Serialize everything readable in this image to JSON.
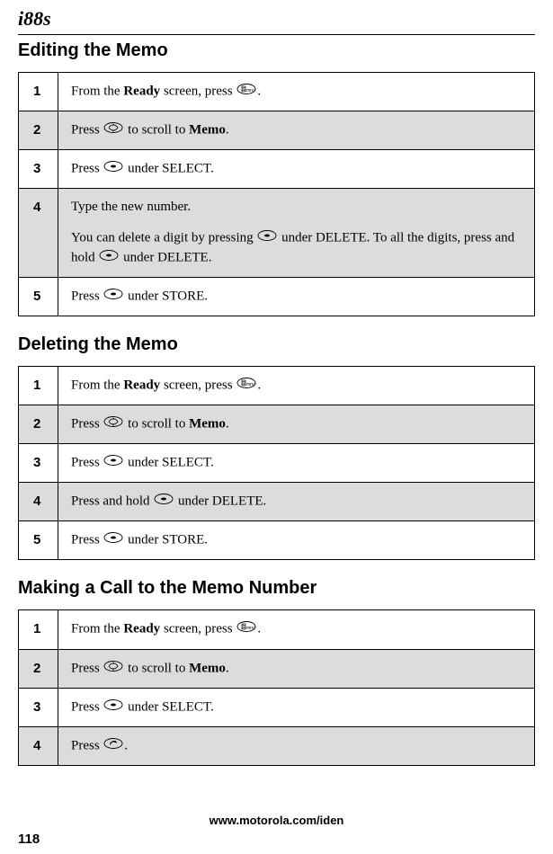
{
  "device_model": "i88s",
  "sections": [
    {
      "title": "Editing the Memo",
      "steps": [
        {
          "num": "1",
          "html": "From the <span class='bold'>Ready</span> screen, press <span class='icon' data-name='menu-icon' data-interactable='false'><svg width='22' height='12' viewBox='0 0 22 12'><ellipse cx='11' cy='6' rx='10' ry='5.5' fill='none' stroke='#000' stroke-width='0.9'/><rect x='6' y='3' width='4' height='6' fill='none' stroke='#000' stroke-width='0.7'/><line x1='6.5' y1='4.5' x2='9.5' y2='4.5' stroke='#000' stroke-width='0.6'/><line x1='6.5' y1='6' x2='9.5' y2='6' stroke='#000' stroke-width='0.6'/><line x1='6.5' y1='7.5' x2='9.5' y2='7.5' stroke='#000' stroke-width='0.6'/><text x='11' y='9' font-size='5' font-family='Arial'>mnu</text></svg></span>."
        },
        {
          "num": "2",
          "html": "Press <span class='icon' data-name='scroll-icon' data-interactable='false'><svg width='22' height='12' viewBox='0 0 22 12'><ellipse cx='11' cy='6' rx='10' ry='5.5' fill='none' stroke='#000' stroke-width='0.9'/><path d='M6 6 Q8 3 11 3 Q14 3 16 6 Q14 9 11 9 Q8 9 6 6' fill='none' stroke='#000' stroke-width='0.8'/><polygon points='11,1.5 9.5,3.5 12.5,3.5' fill='#000'/><polygon points='11,10.5 9.5,8.5 12.5,8.5' fill='#000'/></svg></span> to scroll to <span class='bold'>Memo</span>."
        },
        {
          "num": "3",
          "html": "Press <span class='icon' data-name='softkey-icon' data-interactable='false'><svg width='22' height='12' viewBox='0 0 22 12'><ellipse cx='11' cy='6' rx='10' ry='5.5' fill='none' stroke='#000' stroke-width='0.9'/><ellipse cx='11' cy='6' rx='3' ry='1.5' fill='#000'/></svg></span> under SELECT."
        },
        {
          "num": "4",
          "html": "Type the new number.<span class='para-gap'></span>You can delete a digit by pressing <span class='icon' data-name='softkey-icon' data-interactable='false'><svg width='22' height='12' viewBox='0 0 22 12'><ellipse cx='11' cy='6' rx='10' ry='5.5' fill='none' stroke='#000' stroke-width='0.9'/><ellipse cx='11' cy='6' rx='3' ry='1.5' fill='#000'/></svg></span> under DELETE. To all the digits, press and hold <span class='icon' data-name='softkey-icon' data-interactable='false'><svg width='22' height='12' viewBox='0 0 22 12'><ellipse cx='11' cy='6' rx='10' ry='5.5' fill='none' stroke='#000' stroke-width='0.9'/><ellipse cx='11' cy='6' rx='3' ry='1.5' fill='#000'/></svg></span> under DELETE."
        },
        {
          "num": "5",
          "html": "Press <span class='icon' data-name='softkey-icon' data-interactable='false'><svg width='22' height='12' viewBox='0 0 22 12'><ellipse cx='11' cy='6' rx='10' ry='5.5' fill='none' stroke='#000' stroke-width='0.9'/><ellipse cx='11' cy='6' rx='3' ry='1.5' fill='#000'/></svg></span> under STORE."
        }
      ]
    },
    {
      "title": "Deleting the Memo",
      "steps": [
        {
          "num": "1",
          "html": "From the <span class='bold'>Ready</span> screen, press <span class='icon' data-name='menu-icon' data-interactable='false'><svg width='22' height='12' viewBox='0 0 22 12'><ellipse cx='11' cy='6' rx='10' ry='5.5' fill='none' stroke='#000' stroke-width='0.9'/><rect x='6' y='3' width='4' height='6' fill='none' stroke='#000' stroke-width='0.7'/><line x1='6.5' y1='4.5' x2='9.5' y2='4.5' stroke='#000' stroke-width='0.6'/><line x1='6.5' y1='6' x2='9.5' y2='6' stroke='#000' stroke-width='0.6'/><line x1='6.5' y1='7.5' x2='9.5' y2='7.5' stroke='#000' stroke-width='0.6'/><text x='11' y='9' font-size='5' font-family='Arial'>mnu</text></svg></span>."
        },
        {
          "num": "2",
          "html": "Press <span class='icon' data-name='scroll-icon' data-interactable='false'><svg width='22' height='12' viewBox='0 0 22 12'><ellipse cx='11' cy='6' rx='10' ry='5.5' fill='none' stroke='#000' stroke-width='0.9'/><path d='M6 6 Q8 3 11 3 Q14 3 16 6 Q14 9 11 9 Q8 9 6 6' fill='none' stroke='#000' stroke-width='0.8'/><polygon points='11,1.5 9.5,3.5 12.5,3.5' fill='#000'/><polygon points='11,10.5 9.5,8.5 12.5,8.5' fill='#000'/></svg></span> to scroll to <span class='bold'>Memo</span>."
        },
        {
          "num": "3",
          "html": "Press <span class='icon' data-name='softkey-icon' data-interactable='false'><svg width='22' height='12' viewBox='0 0 22 12'><ellipse cx='11' cy='6' rx='10' ry='5.5' fill='none' stroke='#000' stroke-width='0.9'/><ellipse cx='11' cy='6' rx='3' ry='1.5' fill='#000'/></svg></span> under SELECT."
        },
        {
          "num": "4",
          "html": "Press and hold <span class='icon' data-name='softkey-icon' data-interactable='false'><svg width='22' height='12' viewBox='0 0 22 12'><ellipse cx='11' cy='6' rx='10' ry='5.5' fill='none' stroke='#000' stroke-width='0.9'/><ellipse cx='11' cy='6' rx='3' ry='1.5' fill='#000'/></svg></span> under DELETE."
        },
        {
          "num": "5",
          "html": "Press <span class='icon' data-name='softkey-icon' data-interactable='false'><svg width='22' height='12' viewBox='0 0 22 12'><ellipse cx='11' cy='6' rx='10' ry='5.5' fill='none' stroke='#000' stroke-width='0.9'/><ellipse cx='11' cy='6' rx='3' ry='1.5' fill='#000'/></svg></span> under STORE."
        }
      ]
    },
    {
      "title": "Making a Call to the Memo Number",
      "steps": [
        {
          "num": "1",
          "html": "From the <span class='bold'>Ready</span> screen, press <span class='icon' data-name='menu-icon' data-interactable='false'><svg width='22' height='12' viewBox='0 0 22 12'><ellipse cx='11' cy='6' rx='10' ry='5.5' fill='none' stroke='#000' stroke-width='0.9'/><rect x='6' y='3' width='4' height='6' fill='none' stroke='#000' stroke-width='0.7'/><line x1='6.5' y1='4.5' x2='9.5' y2='4.5' stroke='#000' stroke-width='0.6'/><line x1='6.5' y1='6' x2='9.5' y2='6' stroke='#000' stroke-width='0.6'/><line x1='6.5' y1='7.5' x2='9.5' y2='7.5' stroke='#000' stroke-width='0.6'/><text x='11' y='9' font-size='5' font-family='Arial'>mnu</text></svg></span>."
        },
        {
          "num": "2",
          "html": "Press <span class='icon' data-name='scroll-icon' data-interactable='false'><svg width='22' height='12' viewBox='0 0 22 12'><ellipse cx='11' cy='6' rx='10' ry='5.5' fill='none' stroke='#000' stroke-width='0.9'/><path d='M6 6 Q8 3 11 3 Q14 3 16 6 Q14 9 11 9 Q8 9 6 6' fill='none' stroke='#000' stroke-width='0.8'/><polygon points='11,1.5 9.5,3.5 12.5,3.5' fill='#000'/><polygon points='11,10.5 9.5,8.5 12.5,8.5' fill='#000'/></svg></span> to scroll to <span class='bold'>Memo</span>."
        },
        {
          "num": "3",
          "html": "Press <span class='icon' data-name='softkey-icon' data-interactable='false'><svg width='22' height='12' viewBox='0 0 22 12'><ellipse cx='11' cy='6' rx='10' ry='5.5' fill='none' stroke='#000' stroke-width='0.9'/><ellipse cx='11' cy='6' rx='3' ry='1.5' fill='#000'/></svg></span> under SELECT."
        },
        {
          "num": "4",
          "html": "Press <span class='icon' data-name='call-icon' data-interactable='false'><svg width='22' height='12' viewBox='0 0 22 12'><ellipse cx='11' cy='6' rx='10' ry='5.5' fill='none' stroke='#000' stroke-width='0.9'/><path d='M7 8 Q7 4 11 3 Q15 3 15 5 L14 5.5 Q13 4.5 11 4.5 Q9 4.5 8.5 6.5 Z' fill='#000'/></svg></span>."
        }
      ]
    }
  ],
  "footer_url": "www.motorola.com/iden",
  "page_number": "118"
}
